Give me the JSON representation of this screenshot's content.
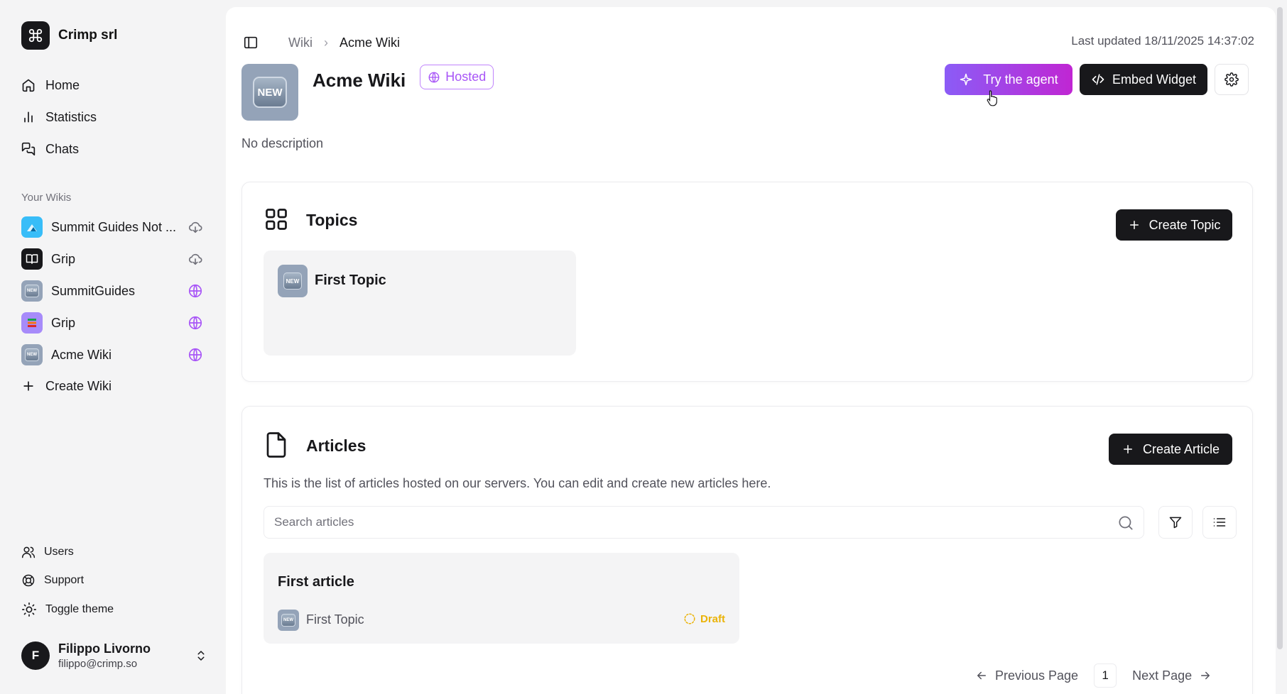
{
  "org": {
    "name": "Crimp srl",
    "logo_icon": "command-icon"
  },
  "nav": [
    {
      "label": "Home",
      "icon": "home-icon"
    },
    {
      "label": "Statistics",
      "icon": "bar-chart-icon"
    },
    {
      "label": "Chats",
      "icon": "chat-bubbles-icon"
    }
  ],
  "wikis_section_label": "Your Wikis",
  "wikis": [
    {
      "name": "Summit Guides Not ...",
      "status_icon": "cloud-download-icon"
    },
    {
      "name": "Grip",
      "status_icon": "cloud-download-icon"
    },
    {
      "name": "SummitGuides",
      "status_icon": "globe-icon"
    },
    {
      "name": "Grip",
      "status_icon": "globe-icon"
    },
    {
      "name": "Acme Wiki",
      "status_icon": "globe-icon"
    }
  ],
  "create_wiki_label": "Create Wiki",
  "bottom_nav": [
    {
      "label": "Users",
      "icon": "users-icon"
    },
    {
      "label": "Support",
      "icon": "lifebuoy-icon"
    },
    {
      "label": "Toggle theme",
      "icon": "sun-icon"
    }
  ],
  "user": {
    "initial": "F",
    "name": "Filippo Livorno",
    "email": "filippo@crimp.so"
  },
  "breadcrumb": {
    "root": "Wiki",
    "separator": "›",
    "current": "Acme Wiki"
  },
  "last_updated": "Last updated 18/11/2025 14:37:02",
  "wiki": {
    "badge_text": "NEW",
    "title": "Acme Wiki",
    "hosted_label": "Hosted",
    "description": "No description"
  },
  "actions": {
    "try_agent": "Try the agent",
    "embed_widget": "Embed Widget"
  },
  "topics": {
    "title": "Topics",
    "create_label": "Create Topic",
    "items": [
      {
        "name": "First Topic",
        "badge": "NEW"
      }
    ]
  },
  "articles": {
    "title": "Articles",
    "create_label": "Create Article",
    "description": "This is the list of articles hosted on our servers. You can edit and create new articles here.",
    "search_placeholder": "Search articles",
    "items": [
      {
        "title": "First article",
        "topic": "First Topic",
        "status": "Draft",
        "badge": "NEW"
      }
    ]
  },
  "pagination": {
    "previous": "Previous Page",
    "page": "1",
    "next": "Next Page"
  },
  "colors": {
    "accent_purple": "#a855f7",
    "agent_gradient_start": "#8b5cf6",
    "agent_gradient_end": "#c026d3",
    "draft": "#eab308",
    "dark": "#18181b"
  }
}
